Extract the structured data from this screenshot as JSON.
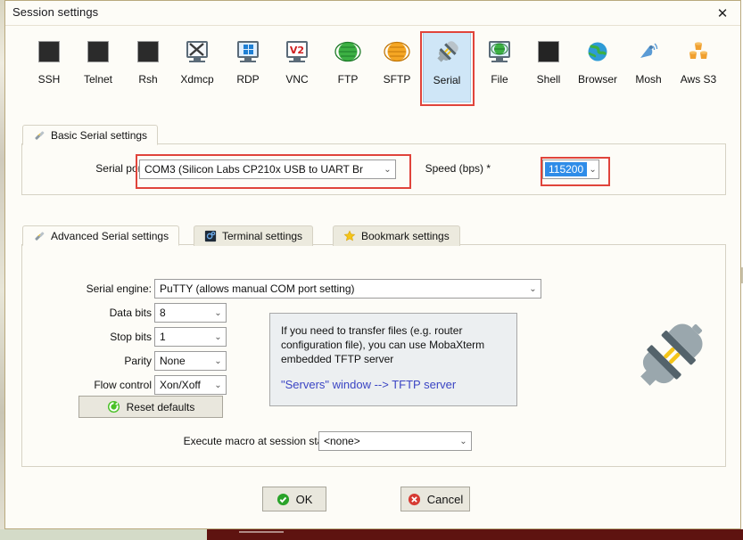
{
  "window": {
    "title": "Session settings",
    "close_label": "✕"
  },
  "session_types": [
    {
      "label": "SSH",
      "icon": "ssh-key-icon",
      "selected": false
    },
    {
      "label": "Telnet",
      "icon": "telnet-gem-icon",
      "selected": false
    },
    {
      "label": "Rsh",
      "icon": "rsh-gears-icon",
      "selected": false
    },
    {
      "label": "Xdmcp",
      "icon": "xdmcp-monitor-icon",
      "selected": false
    },
    {
      "label": "RDP",
      "icon": "rdp-windows-icon",
      "selected": false
    },
    {
      "label": "VNC",
      "icon": "vnc-monitor-icon",
      "selected": false
    },
    {
      "label": "FTP",
      "icon": "ftp-globe-icon",
      "selected": false
    },
    {
      "label": "SFTP",
      "icon": "sftp-globe-icon",
      "selected": false
    },
    {
      "label": "Serial",
      "icon": "serial-plug-icon",
      "selected": true
    },
    {
      "label": "File",
      "icon": "file-monitor-icon",
      "selected": false
    },
    {
      "label": "Shell",
      "icon": "shell-terminal-icon",
      "selected": false
    },
    {
      "label": "Browser",
      "icon": "browser-globe-icon",
      "selected": false
    },
    {
      "label": "Mosh",
      "icon": "mosh-dish-icon",
      "selected": false
    },
    {
      "label": "Aws S3",
      "icon": "aws-s3-buckets-icon",
      "selected": false
    }
  ],
  "basic_panel": {
    "tab_label": "Basic Serial settings",
    "serial_port": {
      "label": "Serial port *",
      "value": "COM3  (Silicon Labs CP210x USB to UART Br"
    },
    "speed": {
      "label": "Speed (bps) *",
      "value": "115200"
    }
  },
  "advanced_panel": {
    "tabs": [
      {
        "label": "Advanced Serial settings",
        "icon": "serial-plug-icon",
        "active": true
      },
      {
        "label": "Terminal settings",
        "icon": "terminal-gear-icon",
        "active": false
      },
      {
        "label": "Bookmark settings",
        "icon": "bookmark-star-icon",
        "active": false
      }
    ],
    "fields": [
      {
        "label": "Serial engine:",
        "value": "PuTTY   (allows manual COM port setting)"
      },
      {
        "label": "Data bits",
        "value": "8"
      },
      {
        "label": "Stop bits",
        "value": "1"
      },
      {
        "label": "Parity",
        "value": "None"
      },
      {
        "label": "Flow control",
        "value": "Xon/Xoff"
      }
    ],
    "reset_button": "Reset defaults",
    "tftp_note": {
      "line1": "If you need to transfer files (e.g. router",
      "line2": "configuration file), you can use MobaXterm",
      "line3": "embedded TFTP server",
      "link": "\"Servers\" window  -->  TFTP server"
    },
    "macro": {
      "label": "Execute macro at session start:",
      "value": "<none>"
    }
  },
  "footer": {
    "ok_label": "OK",
    "cancel_label": "Cancel"
  },
  "colors": {
    "accent_red": "#e0443b",
    "selection_blue": "#2f8ce8",
    "selected_tab_bg": "#cfe6f7",
    "link_blue": "#3b45c4",
    "ok_green": "#29a329",
    "cancel_red": "#d63b33"
  }
}
